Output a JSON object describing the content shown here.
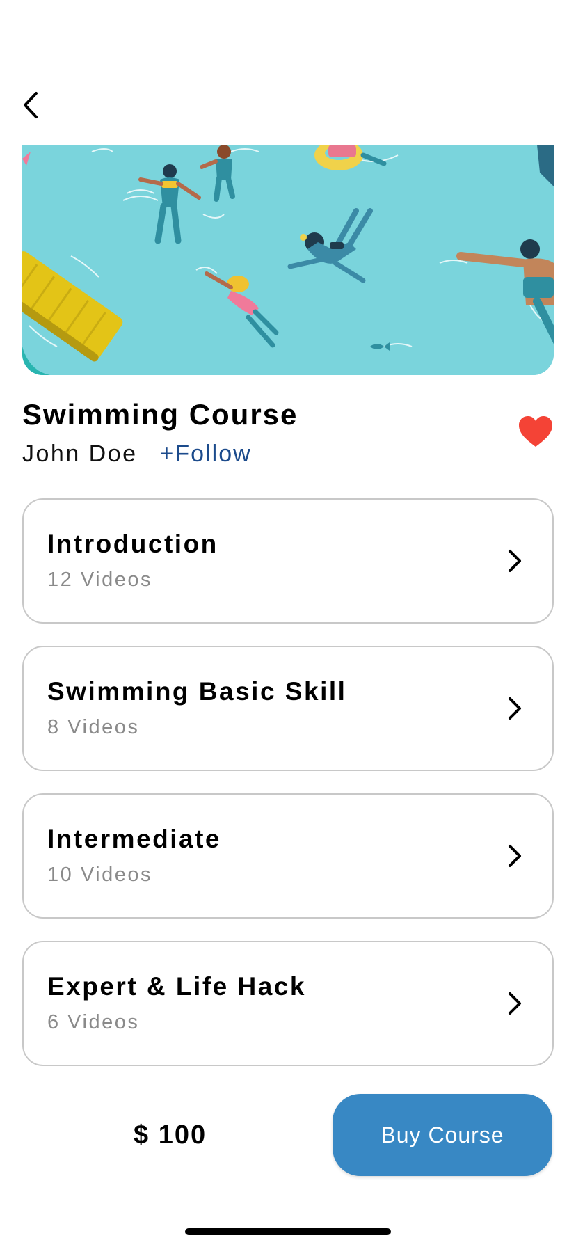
{
  "nav": {
    "back_icon": "chevron-left-icon"
  },
  "hero": {
    "image": "swimming-pool-illustration"
  },
  "course": {
    "title": "Swimming Course",
    "author": "John Doe",
    "follow_label": "+Follow",
    "favorite_icon": "heart-icon",
    "favorite_color": "#f44336"
  },
  "modules": [
    {
      "title": "Introduction",
      "count": "12 Videos"
    },
    {
      "title": "Swimming Basic Skill",
      "count": "8 Videos"
    },
    {
      "title": "Intermediate",
      "count": "10 Videos"
    },
    {
      "title": "Expert & Life Hack",
      "count": "6 Videos"
    }
  ],
  "footer": {
    "price": "$ 100",
    "buy_label": "Buy Course",
    "buy_color": "#3888c4"
  }
}
